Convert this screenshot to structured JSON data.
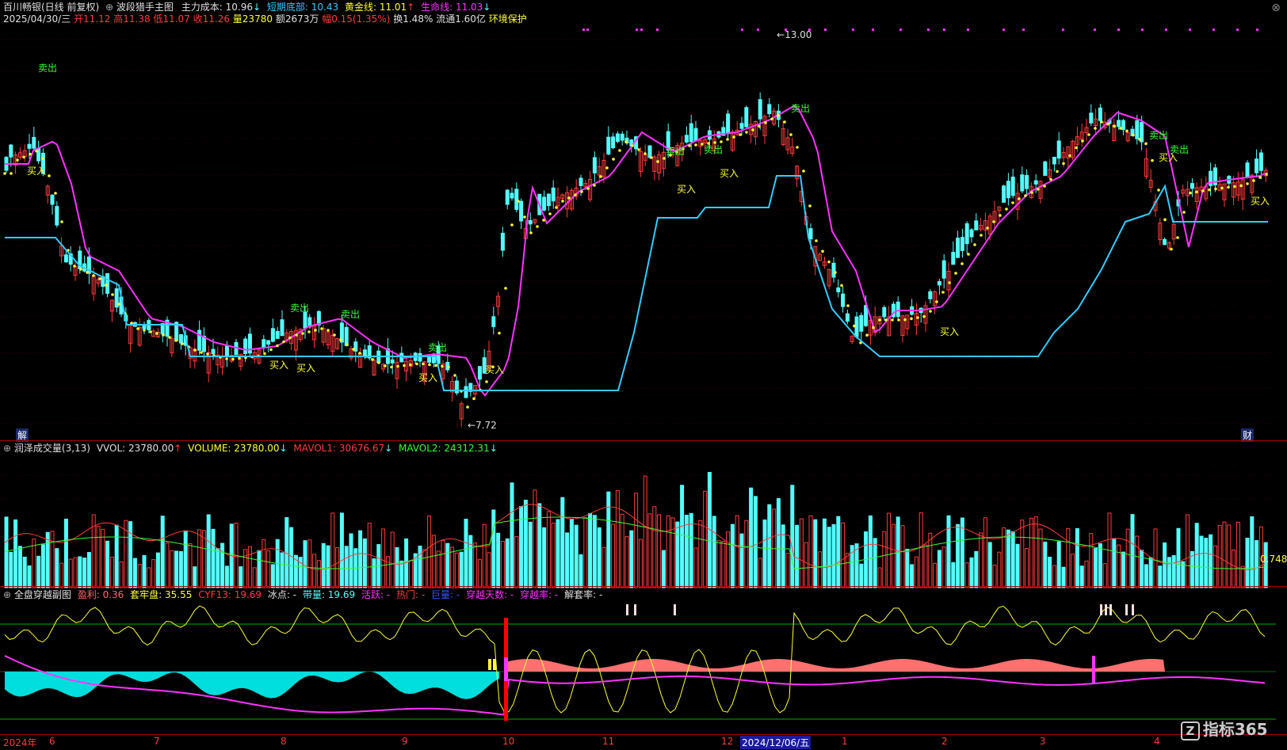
{
  "header": {
    "stock_name": "百川畅银(日线 前复权)",
    "indicator_name": "波段猎手主图",
    "main_cost_label": "主力成本:",
    "main_cost_value": "10.96",
    "short_bottom_label": "短期底部:",
    "short_bottom_value": "10.43",
    "golden_line_label": "黄金线:",
    "golden_line_value": "11.01",
    "life_line_label": "生命线:",
    "life_line_value": "11.03",
    "date": "2025/04/30/三",
    "open": "开11.12",
    "high": "高11.38",
    "low": "低11.07",
    "close": "收11.26",
    "volume": "量23780",
    "amount": "额2673万",
    "change": "幅0.15(1.35%)",
    "turnover": "换1.48%",
    "float": "流通1.60亿",
    "env": "环境保护",
    "close_icon": "close-icon"
  },
  "main_chart": {
    "max_label": "13.00",
    "min_label": "7.72",
    "sell_label": "卖出",
    "buy_label": "买入",
    "corner_left": "解",
    "corner_right": "财",
    "colors": {
      "up": "#ff3b3b",
      "down": "#54ffff",
      "life": "#ff33ff",
      "golden": "#ffff33",
      "support": "#33ccff"
    }
  },
  "volume_panel": {
    "title": "润泽成交量(3,13)",
    "vvol": "VVOL: 23780.00",
    "volume": "VOLUME: 23780.00",
    "mavol1": "MAVOL1: 30676.67",
    "mavol2": "MAVOL2: 24312.31",
    "right_value": "0.748"
  },
  "sub_panel": {
    "title": "全盘穿越副图",
    "profit": "盈利: 0.36",
    "trapped": "套牢盘: 35.55",
    "cyf": "CYF13: 19.69",
    "ice": "冰点: -",
    "belt": "带量: 19.69",
    "active": "活跃: -",
    "hot": "热门: -",
    "huge": "巨量: -",
    "cross_days": "穿越天数: -",
    "cross_rate": "穿越率: -",
    "untrap_rate": "解套率: -"
  },
  "time_axis": {
    "year": "2024年",
    "months": [
      "6",
      "7",
      "8",
      "9",
      "10",
      "11",
      "12",
      "1",
      "2",
      "3",
      "4"
    ],
    "cursor_date": "2024/12/06/五"
  },
  "watermark": {
    "brand": "指标365",
    "logo_letter": "Z"
  }
}
